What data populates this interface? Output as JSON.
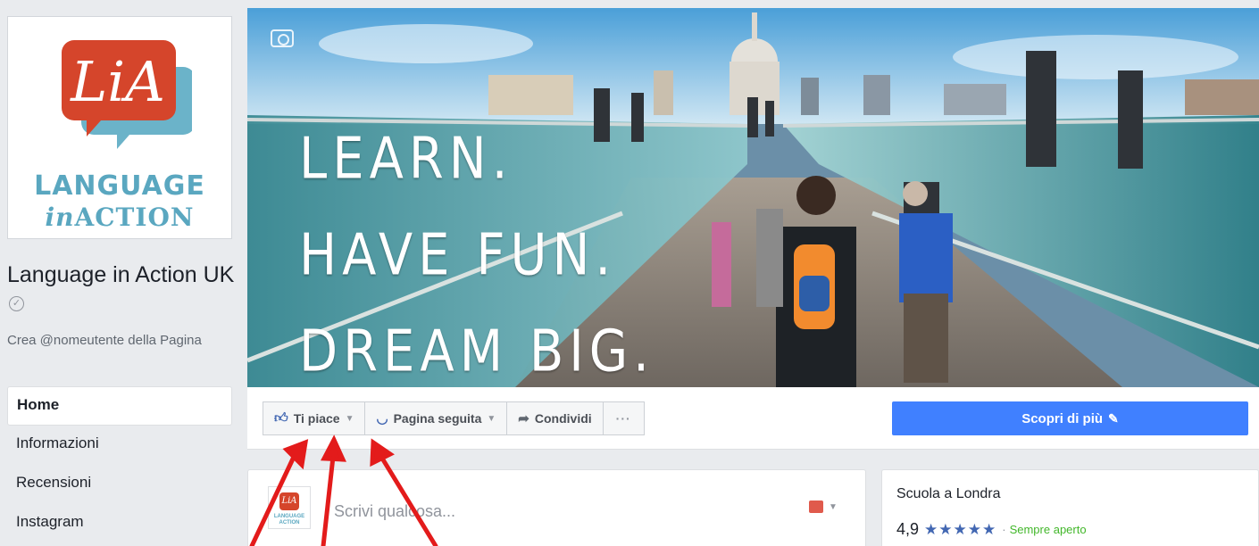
{
  "page": {
    "name": "Language in Action UK",
    "username_prompt": "Crea @nomeutente della Pagina",
    "logo": {
      "monogram": "LiA",
      "line1": "LANGUAGE",
      "line2_prefix": "in",
      "line2_word": "ACTION"
    }
  },
  "nav": {
    "items": [
      {
        "label": "Home",
        "active": true
      },
      {
        "label": "Informazioni"
      },
      {
        "label": "Recensioni"
      },
      {
        "label": "Instagram"
      }
    ]
  },
  "cover": {
    "lines": [
      "LEARN.",
      "HAVE FUN.",
      "DREAM BIG."
    ]
  },
  "actions": {
    "like_label": "Ti piace",
    "follow_label": "Pagina seguita",
    "share_label": "Condividi",
    "more_label": "···",
    "cta_label": "Scopri di più"
  },
  "composer": {
    "placeholder": "Scrivi qualcosa..."
  },
  "info": {
    "category": "Scuola a Londra",
    "rating": "4,9",
    "stars": "★★★★★",
    "separator": "·",
    "status": "Sempre aperto"
  },
  "colors": {
    "facebook_blue": "#4267b2",
    "cta_blue": "#4080ff",
    "logo_red": "#d5452b",
    "logo_teal": "#5aa7c0",
    "open_green": "#42b72a",
    "arrow_red": "#e31b1b"
  }
}
